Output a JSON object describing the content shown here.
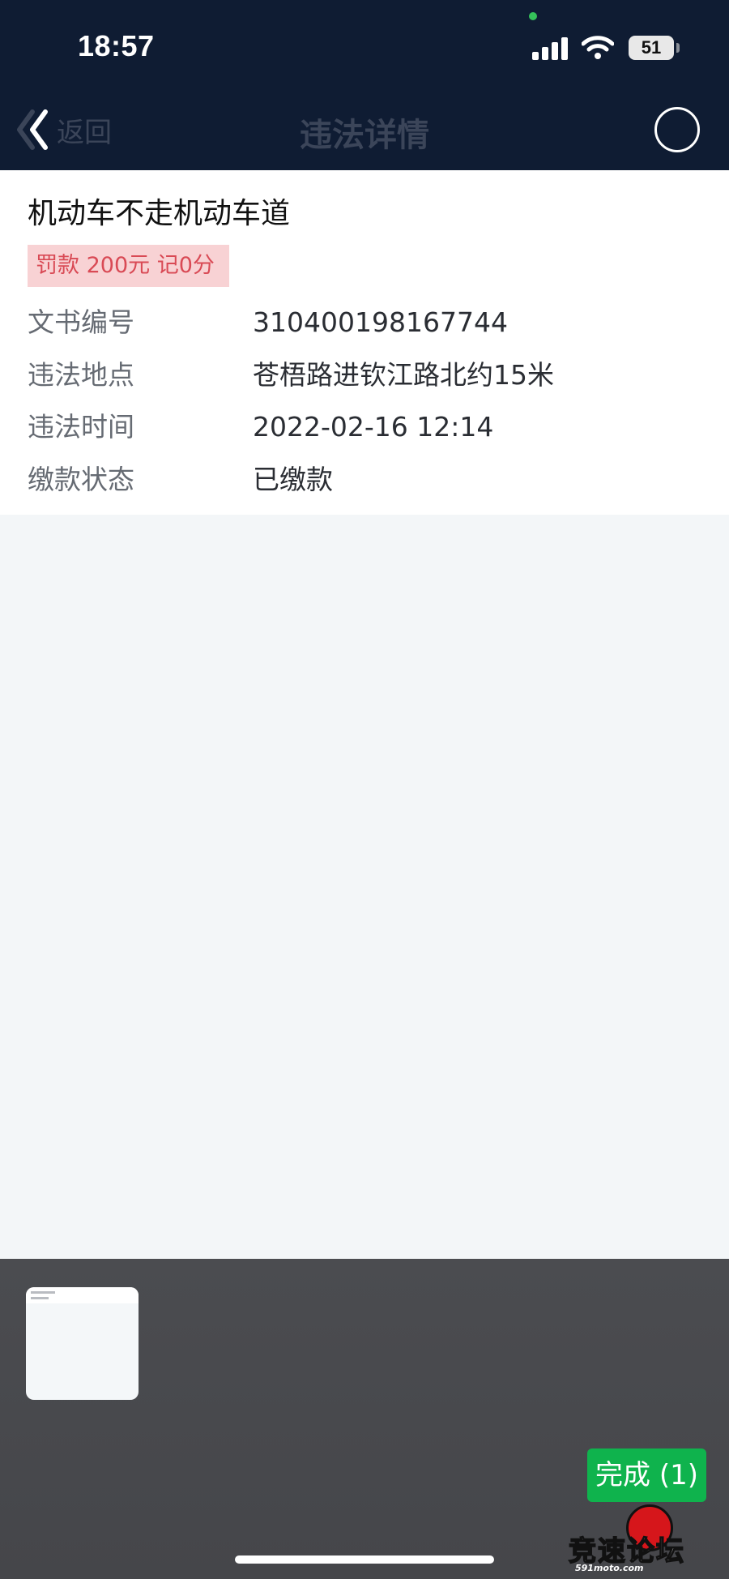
{
  "status_bar": {
    "time": "18:57",
    "battery": "51",
    "icons": [
      "signal-icon",
      "wifi-icon",
      "battery-icon"
    ]
  },
  "nav": {
    "back_label": "返回",
    "title": "违法详情"
  },
  "violation": {
    "title": "机动车不走机动车道",
    "penalty": "罚款 200元 记0分",
    "fields": [
      {
        "label": "文书编号",
        "value": "310400198167744"
      },
      {
        "label": "违法地点",
        "value": "苍梧路进钦江路北约15米"
      },
      {
        "label": "违法时间",
        "value": "2022-02-16 12:14"
      },
      {
        "label": "缴款状态",
        "value": "已缴款"
      }
    ]
  },
  "screenshot_tray": {
    "done_label": "完成 (1)"
  },
  "watermark": {
    "text": "竞速论坛",
    "site": "591moto.com"
  },
  "colors": {
    "header_bg": "#0f1c33",
    "penalty_bg": "#f8d2d4",
    "penalty_text": "#d94a55",
    "done_button": "#0fb34d",
    "tray_bg": "#4b4c50"
  }
}
